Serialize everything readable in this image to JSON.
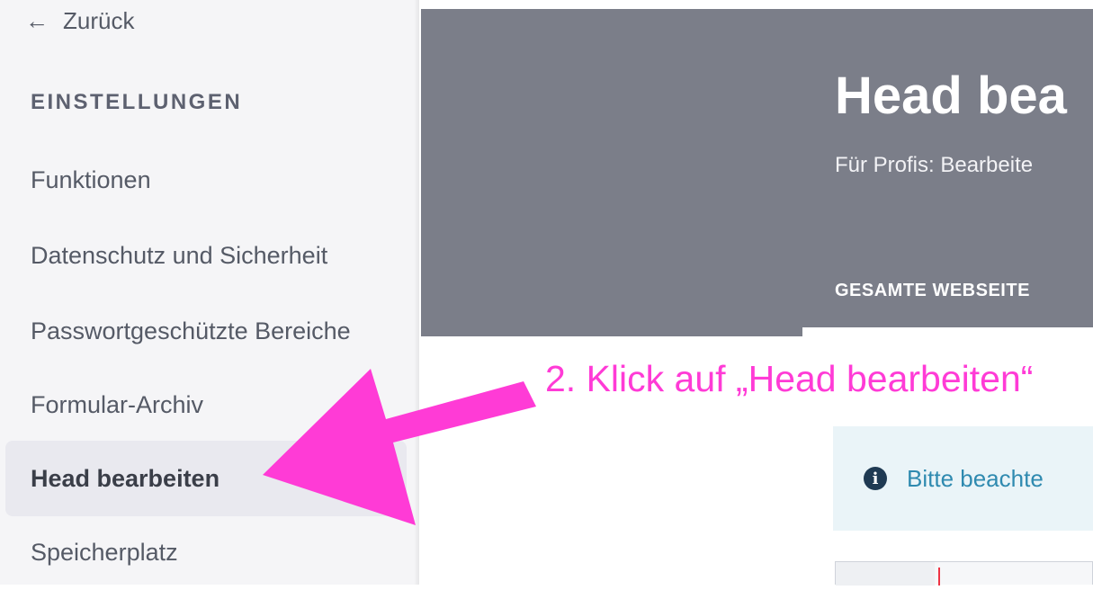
{
  "sidebar": {
    "back_label": "Zurück",
    "section_title": "EINSTELLUNGEN",
    "items": [
      {
        "label": "Funktionen"
      },
      {
        "label": "Datenschutz und Sicherheit"
      },
      {
        "label": "Passwortgeschützte Bereiche"
      },
      {
        "label": "Formular-Archiv"
      },
      {
        "label": "Head bearbeiten",
        "active": true
      },
      {
        "label": "Speicherplatz"
      }
    ]
  },
  "header": {
    "title": "Head bea",
    "subtitle": "Für Profis: Bearbeite",
    "tab_label": "GESAMTE WEBSEITE"
  },
  "annotation": {
    "text": "2. Klick auf „Head bearbeiten“",
    "color": "#ff3bd6"
  },
  "notice": {
    "text": "Bitte beachte",
    "icon": "info-icon"
  },
  "colors": {
    "header_bg": "#7b7e89",
    "sidebar_bg": "#f5f5f7",
    "accent_pink": "#ff3bd6"
  }
}
